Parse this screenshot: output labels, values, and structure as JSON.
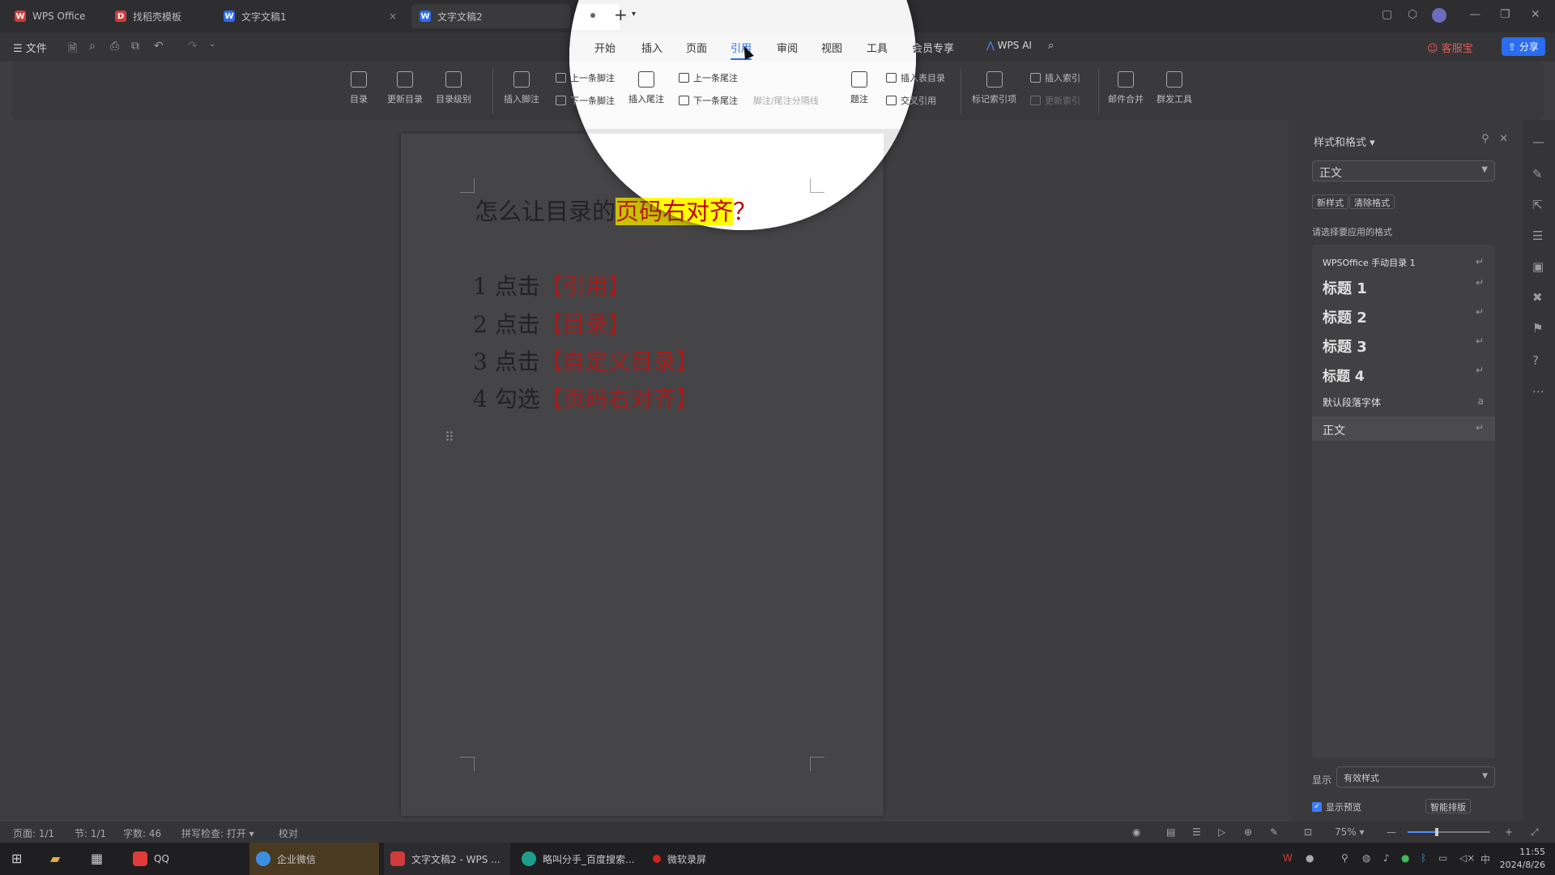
{
  "tabs": [
    {
      "label": "WPS Office",
      "color": "#d13b3b"
    },
    {
      "label": "找稻壳模板",
      "color": "#d13b3b"
    },
    {
      "label": "文字文稿1",
      "color": "#2b6cf0"
    },
    {
      "label": "文字文稿2",
      "color": "#2b6cf0"
    }
  ],
  "menubar": {
    "file_label": "文件",
    "items": [
      "开始",
      "插入",
      "页面",
      "引用",
      "审阅",
      "视图",
      "工具",
      "会员专享"
    ],
    "active": "引用",
    "wps_ai": "WPS AI",
    "service": "客服宝",
    "share": "分享"
  },
  "ribbon": {
    "toc": "目录",
    "update_toc": "更新目录",
    "toc_level": "目录级别",
    "insert_footnote": "插入脚注",
    "prev_footnote": "上一条脚注",
    "next_footnote": "下一条脚注",
    "insert_endnote": "插入尾注",
    "prev_endnote": "上一条尾注",
    "next_endnote": "下一条尾注",
    "separator_line": "脚注/尾注分隔线",
    "caption": "题注",
    "insert_table_of_figures": "插入表目录",
    "cross_reference": "交叉引用",
    "mark_index_entry": "标记索引项",
    "insert_index": "插入索引",
    "update_index": "更新索引",
    "mail_merge": "邮件合并",
    "mass_send": "群发工具"
  },
  "document": {
    "title_prefix": "怎么让目录的",
    "title_highlight": "页码右对齐",
    "title_suffix": "？",
    "steps": [
      {
        "num": "1",
        "verb": "点击",
        "target": "【引用】"
      },
      {
        "num": "2",
        "verb": "点击",
        "target": "【目录】"
      },
      {
        "num": "3",
        "verb": "点击",
        "target": "【自定义目录】"
      },
      {
        "num": "4",
        "verb": "勾选",
        "target": "【页码右对齐】"
      }
    ]
  },
  "styles_panel": {
    "title": "样式和格式",
    "current_style": "正文",
    "new_style": "新样式",
    "clear_format": "清除格式",
    "hint": "请选择要应用的格式",
    "items": [
      {
        "label": "WPSOffice 手动目录 1",
        "kind": "small"
      },
      {
        "label": "标题 1",
        "kind": "heading"
      },
      {
        "label": "标题 2",
        "kind": "heading"
      },
      {
        "label": "标题 3",
        "kind": "heading"
      },
      {
        "label": "标题 4",
        "kind": "heading"
      },
      {
        "label": "默认段落字体",
        "kind": "small"
      },
      {
        "label": "正文",
        "kind": "normal"
      }
    ],
    "show_label": "显示",
    "show_value": "有效样式",
    "preview_label": "显示预览",
    "smart_layout": "智能排版"
  },
  "statusbar": {
    "page": "页面: 1/1",
    "section": "节: 1/1",
    "word_count": "字数: 46",
    "spell_check": "拼写检查: 打开",
    "proofread": "校对",
    "zoom": "75%"
  },
  "taskbar": {
    "items": [
      "QQ",
      "企业微信",
      "文字文稿2 - WPS ...",
      "略叫分手_百度搜索...",
      "微软录屏"
    ],
    "time": "11:55",
    "date": "2024/8/26",
    "ime": "中"
  }
}
